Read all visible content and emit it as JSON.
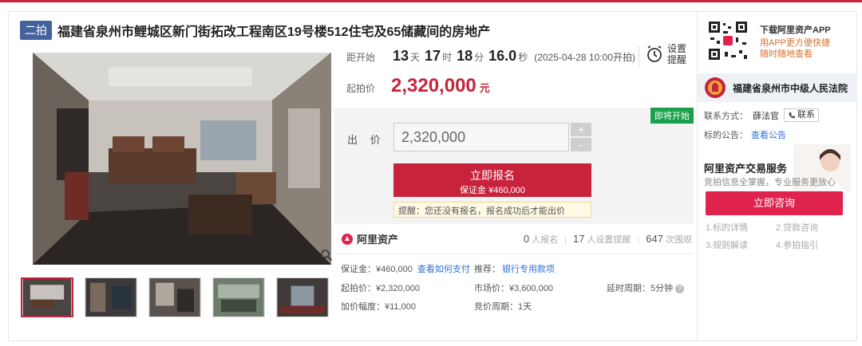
{
  "listing": {
    "tag": "二拍",
    "title": "福建省泉州市鲤城区新门街拓改工程南区19号楼512住宅及65储藏间的房地产"
  },
  "countdown": {
    "label": "距开始",
    "days": "13",
    "days_unit": "天",
    "hours": "17",
    "hours_unit": "时",
    "minutes": "18",
    "minutes_unit": "分",
    "seconds": "16.0",
    "seconds_unit": "秒",
    "start_time": "(2025-04-28 10:00开拍)"
  },
  "remind": {
    "label": "设置提醒",
    "icon": "alarm-clock-icon"
  },
  "start_price": {
    "label": "起拍价",
    "value": "2,320,000",
    "unit": "元"
  },
  "bid": {
    "status_badge": "即将开始",
    "label": "出 价",
    "input_value": "2,320,000",
    "plus": "+",
    "minus": "-",
    "signup_label": "立即报名",
    "deposit_label": "保证金 ¥460,000",
    "tip": "提醒：您还没有报名，报名成功后才能出价"
  },
  "stats": {
    "brand": "阿里资产",
    "signups": "0",
    "signups_label": "人报名",
    "reminders": "17",
    "reminders_label": "人设置提醒",
    "views": "647",
    "views_label": "次围观"
  },
  "details": {
    "deposit": "保证金：¥460,000",
    "deposit_link": "查看如何支付",
    "recommend": "推荐：",
    "recommend_link": "银行专用款项",
    "start_price": "起拍价：¥2,320,000",
    "market_price": "市场价：¥3,600,000",
    "delay": "延时周期：5分钟",
    "increment": "加价幅度：¥11,000",
    "cycle": "竞价周期：1天"
  },
  "sidebar": {
    "app_title": "下载阿里资产APP",
    "app_desc_1": "用APP更方便快捷",
    "app_desc_2": "随时随地查看",
    "court": "福建省泉州市中级人民法院",
    "contact_label": "联系方式：",
    "contact_name": "薛法官",
    "contact_button": "联系",
    "notice_label": "标的公告：",
    "notice_link": "查看公告",
    "service_title": "阿里资产交易服务",
    "service_desc": "竞拍信息全掌握，专业服务更放心",
    "consult_button": "立即咨询",
    "links": [
      "1.标的详情",
      "2.贷款咨询",
      "3.规则解读",
      "4.参拍指引"
    ]
  },
  "colors": {
    "accent": "#c8233d",
    "tag": "#44629e",
    "soon": "#19a04b",
    "link": "#2f6fd6"
  }
}
